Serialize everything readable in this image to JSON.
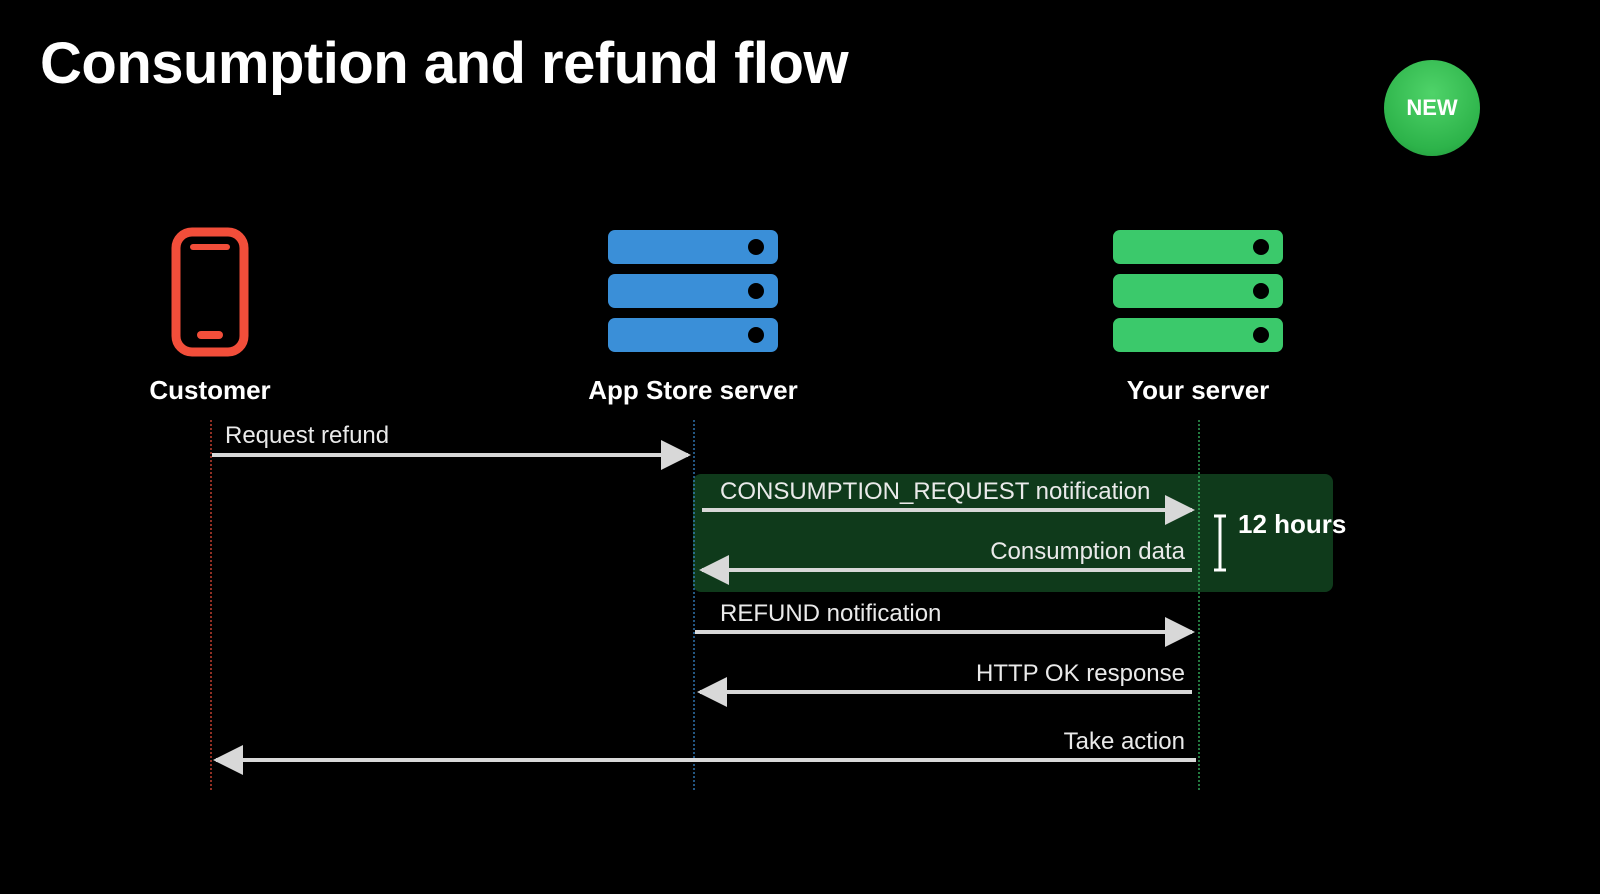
{
  "title": "Consumption and refund flow",
  "badge": "NEW",
  "actors": {
    "customer": "Customer",
    "appstore": "App Store server",
    "yourserver": "Your server"
  },
  "messages": {
    "request_refund": "Request refund",
    "consumption_request": "CONSUMPTION_REQUEST notification",
    "consumption_data": "Consumption data",
    "refund_notification": "REFUND notification",
    "http_ok": "HTTP OK response",
    "take_action": "Take action"
  },
  "duration": "12 hours",
  "colors": {
    "customer_icon": "#f24e3a",
    "appstore_icon": "#3a8fd8",
    "yourserver_icon": "#3bc96b",
    "highlight_bg": "#0f3a1b",
    "badge_green": "#2db34a"
  }
}
